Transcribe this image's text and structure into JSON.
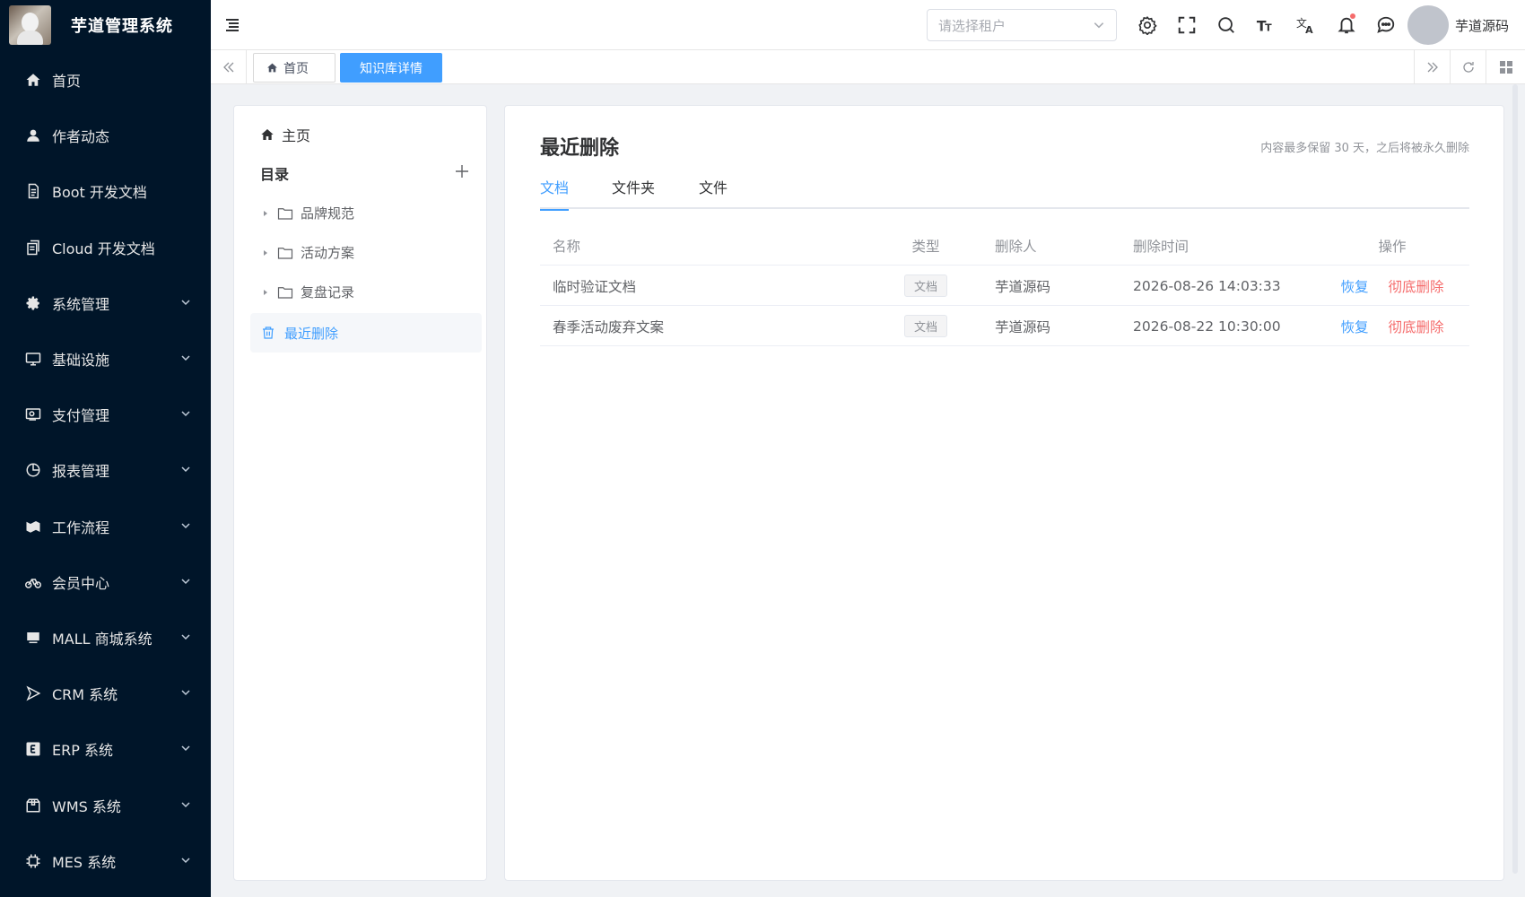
{
  "app": {
    "title": "芋道管理系统"
  },
  "sidebar": {
    "items": [
      {
        "label": "首页",
        "icon": "home-icon",
        "expandable": false
      },
      {
        "label": "作者动态",
        "icon": "user-icon",
        "expandable": false
      },
      {
        "label": "Boot 开发文档",
        "icon": "document-icon",
        "expandable": false
      },
      {
        "label": "Cloud 开发文档",
        "icon": "document-copy-icon",
        "expandable": false
      },
      {
        "label": "系统管理",
        "icon": "gear-icon",
        "expandable": true
      },
      {
        "label": "基础设施",
        "icon": "monitor-icon",
        "expandable": true
      },
      {
        "label": "支付管理",
        "icon": "payment-icon",
        "expandable": true
      },
      {
        "label": "报表管理",
        "icon": "pie-chart-icon",
        "expandable": true
      },
      {
        "label": "工作流程",
        "icon": "workflow-icon",
        "expandable": true
      },
      {
        "label": "会员中心",
        "icon": "bicycle-icon",
        "expandable": true
      },
      {
        "label": "MALL 商城系统",
        "icon": "shop-icon",
        "expandable": true
      },
      {
        "label": "CRM 系统",
        "icon": "crm-icon",
        "expandable": true
      },
      {
        "label": "ERP 系统",
        "icon": "erp-icon",
        "expandable": true
      },
      {
        "label": "WMS 系统",
        "icon": "box-icon",
        "expandable": true
      },
      {
        "label": "MES 系统",
        "icon": "chip-icon",
        "expandable": true
      }
    ]
  },
  "header": {
    "tenant_placeholder": "请选择租户",
    "username": "芋道源码"
  },
  "tags": {
    "home": "首页",
    "active": "知识库详情"
  },
  "tree": {
    "home": "主页",
    "catalog": "目录",
    "nodes": [
      "品牌规范",
      "活动方案",
      "复盘记录"
    ],
    "recently_deleted": "最近删除"
  },
  "main": {
    "title": "最近删除",
    "hint": "内容最多保留 30 天，之后将被永久删除",
    "tabs": [
      "文档",
      "文件夹",
      "文件"
    ],
    "active_tab": 0,
    "columns": [
      "名称",
      "类型",
      "删除人",
      "删除时间",
      "操作"
    ],
    "rows": [
      {
        "name": "临时验证文档",
        "type": "文档",
        "deleter": "芋道源码",
        "time": "2026-08-26 14:03:33",
        "restore": "恢复",
        "purge": "彻底删除"
      },
      {
        "name": "春季活动废弃文案",
        "type": "文档",
        "deleter": "芋道源码",
        "time": "2026-08-22 10:30:00",
        "restore": "恢复",
        "purge": "彻底删除"
      }
    ]
  },
  "colors": {
    "sidebar_bg": "#001529",
    "primary": "#409eff",
    "danger": "#f56c6c"
  }
}
